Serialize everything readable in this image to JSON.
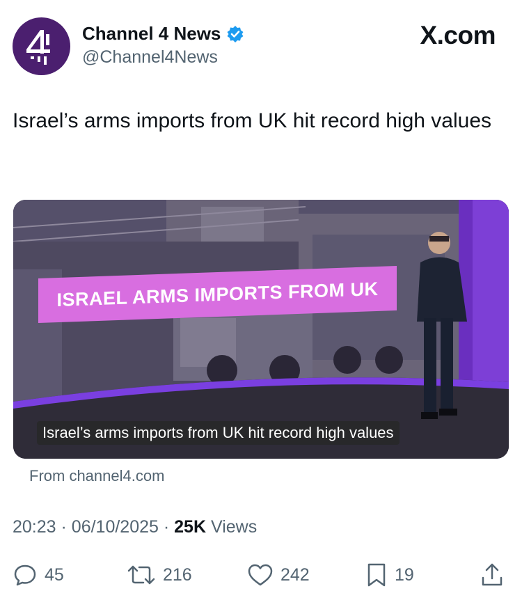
{
  "account": {
    "display_name": "Channel 4 News",
    "handle": "@Channel4News",
    "verified": true,
    "avatar_icon": "channel-4-logo"
  },
  "brand": {
    "label": "X.com"
  },
  "tweet": {
    "text": "Israel’s arms imports from UK hit record high values"
  },
  "media_card": {
    "graphic_title": "ISRAEL ARMS IMPORTS FROM UK",
    "caption": "Israel’s arms imports from UK hit record high values",
    "source": "From channel4.com"
  },
  "meta": {
    "time": "20:23",
    "date": "06/10/2025",
    "views_count": "25K",
    "views_label": "Views",
    "separator": "·"
  },
  "actions": {
    "replies": "45",
    "reposts": "216",
    "likes": "242",
    "bookmarks": "19"
  },
  "colors": {
    "verified_blue": "#1d9bf0",
    "channel4_purple": "#4b1f6f",
    "graphic_pink": "#d86ee0",
    "muted_text": "#536471"
  }
}
